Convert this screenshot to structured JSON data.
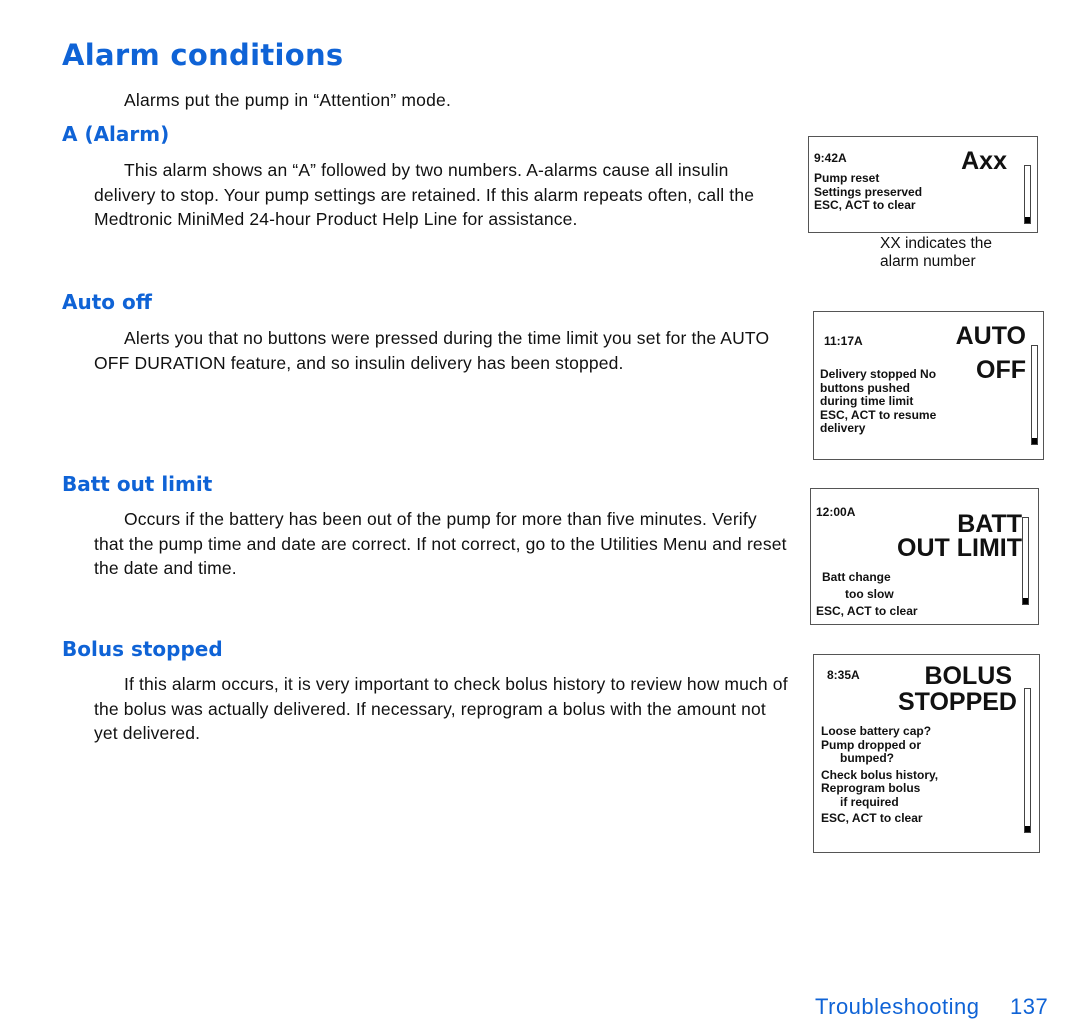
{
  "page": {
    "title": "Alarm conditions",
    "intro": "Alarms put the pump in “Attention” mode."
  },
  "sections": [
    {
      "heading": "A (Alarm)",
      "body": "This alarm shows an “A” followed by two numbers. A-alarms cause all insulin delivery to stop. Your pump settings are retained. If this alarm repeats often, call the Medtronic MiniMed 24-hour Product Help Line for assistance."
    },
    {
      "heading": "Auto off",
      "body": "Alerts you that no buttons were pressed during the time limit you set for the AUTO OFF DURATION feature, and so insulin delivery has been stopped."
    },
    {
      "heading": "Batt out limit",
      "body": "Occurs if the battery has been out of the pump for more than five minutes. Verify that the pump time and date are correct. If not correct, go to the Utilities Menu and reset the date and time."
    },
    {
      "heading": "Bolus stopped",
      "body": "If this alarm occurs, it is very important to check bolus history to review how much of the bolus was actually delivered. If necessary, reprogram a bolus with the amount not yet delivered."
    }
  ],
  "screens": [
    {
      "time": "9:42A",
      "title_lines": [
        "Axx"
      ],
      "message_lines": [
        "Pump reset",
        "Settings preserved",
        "ESC, ACT to clear"
      ],
      "caption": "XX indicates the alarm number"
    },
    {
      "time": "11:17A",
      "title_lines": [
        "AUTO",
        "OFF"
      ],
      "message_lines": [
        "Delivery stopped No",
        "buttons pushed",
        "during time limit",
        "ESC, ACT to resume",
        "delivery"
      ]
    },
    {
      "time": "12:00A",
      "title_lines": [
        "BATT",
        "OUT LIMIT"
      ],
      "message_lines": [
        "Batt change",
        "too slow",
        "ESC, ACT to clear"
      ]
    },
    {
      "time": "8:35A",
      "title_lines": [
        "BOLUS",
        "STOPPED"
      ],
      "message_lines": [
        "Loose battery cap?",
        "Pump dropped or",
        "bumped?",
        "Check bolus history,",
        "Reprogram bolus",
        "if required",
        "ESC, ACT to clear"
      ]
    }
  ],
  "footer": {
    "chapter": "Troubleshooting",
    "page_number": "137"
  }
}
